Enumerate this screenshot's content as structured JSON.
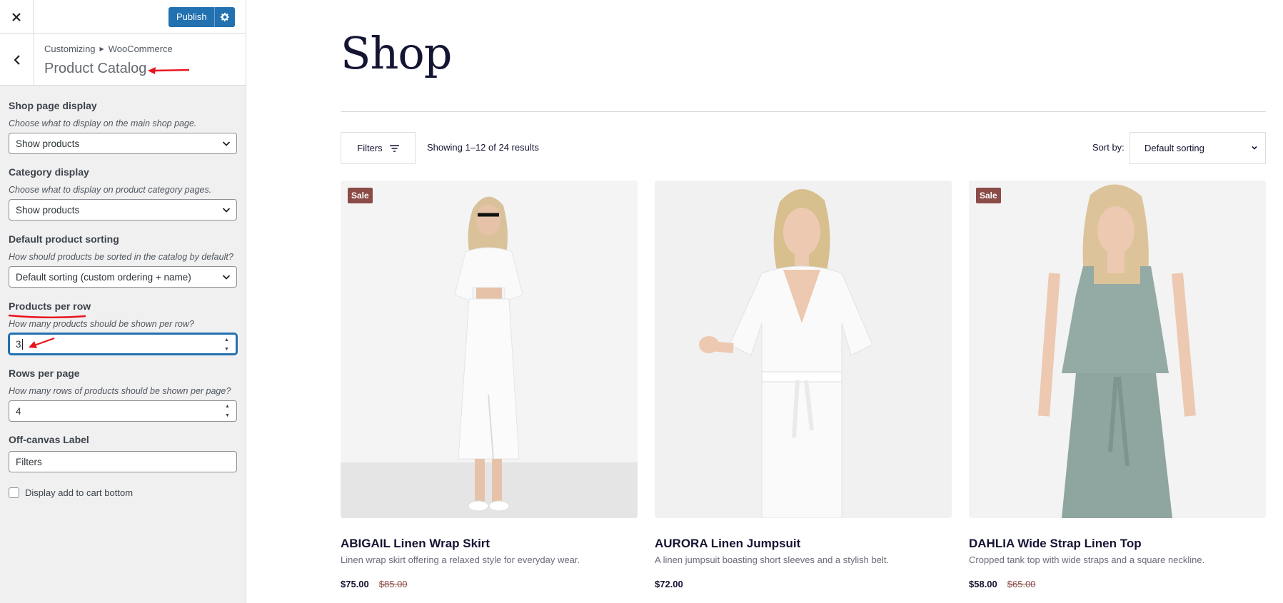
{
  "customizer": {
    "publish_label": "Publish",
    "breadcrumb": [
      "Customizing",
      "WooCommerce"
    ],
    "section_title": "Product Catalog",
    "controls": {
      "shop_page_display": {
        "title": "Shop page display",
        "description": "Choose what to display on the main shop page.",
        "value": "Show products"
      },
      "category_display": {
        "title": "Category display",
        "description": "Choose what to display on product category pages.",
        "value": "Show products"
      },
      "default_sorting": {
        "title": "Default product sorting",
        "description": "How should products be sorted in the catalog by default?",
        "value": "Default sorting (custom ordering + name)"
      },
      "products_per_row": {
        "title": "Products per row",
        "description": "How many products should be shown per row?",
        "value": "3"
      },
      "rows_per_page": {
        "title": "Rows per page",
        "description": "How many rows of products should be shown per page?",
        "value": "4"
      },
      "offcanvas_label": {
        "title": "Off-canvas Label",
        "value": "Filters"
      },
      "add_to_cart_bottom": {
        "label": "Display add to cart bottom",
        "checked": false
      }
    }
  },
  "shop": {
    "title": "Shop",
    "filters_label": "Filters",
    "result_count": "Showing 1–12 of 24 results",
    "sort_label": "Sort by:",
    "sort_value": "Default sorting",
    "products": [
      {
        "name": "ABIGAIL Linen Wrap Skirt",
        "description": "Linen wrap skirt offering a relaxed style for everyday wear.",
        "price": "$75.00",
        "old_price": "$85.00",
        "badge": "Sale"
      },
      {
        "name": "AURORA Linen Jumpsuit",
        "description": "A linen jumpsuit boasting short sleeves and a stylish belt.",
        "price": "$72.00",
        "old_price": "",
        "badge": ""
      },
      {
        "name": "DAHLIA Wide Strap Linen Top",
        "description": "Cropped tank top with wide straps and a square neckline.",
        "price": "$58.00",
        "old_price": "$65.00",
        "badge": "Sale"
      }
    ]
  },
  "colors": {
    "accent": "#2271b1",
    "sale_badge": "#8b4b47",
    "annotation": "#e8141c",
    "heading": "#141433"
  }
}
